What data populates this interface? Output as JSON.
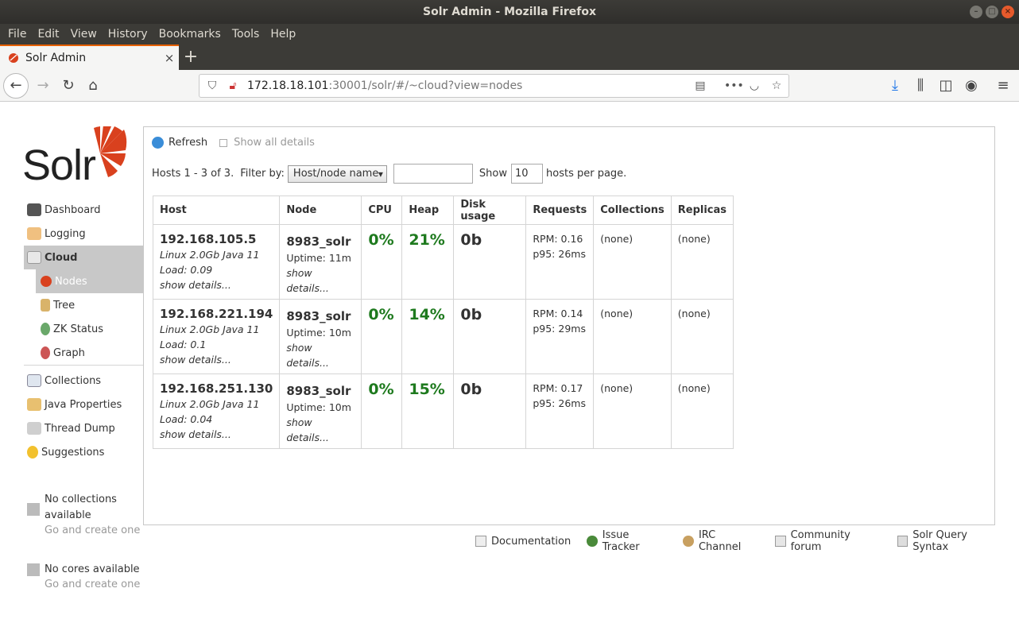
{
  "window": {
    "title": "Solr Admin - Mozilla Firefox",
    "buttons": [
      "–",
      "□",
      "×"
    ]
  },
  "menu": [
    "File",
    "Edit",
    "View",
    "History",
    "Bookmarks",
    "Tools",
    "Help"
  ],
  "tab": {
    "title": "Solr Admin",
    "close": "×",
    "new_tab": "+"
  },
  "url": {
    "host": "172.18.18.101",
    "rest": ":30001/solr/#/~cloud?view=nodes"
  },
  "logo_text": "Solr",
  "sidebar": {
    "items": [
      {
        "label": "Dashboard",
        "icon": "dashboard-icon"
      },
      {
        "label": "Logging",
        "icon": "logging-icon"
      },
      {
        "label": "Cloud",
        "icon": "cloud-icon",
        "active": true
      }
    ],
    "cloud_sub": [
      {
        "label": "Nodes",
        "icon": "solr-icon",
        "active": true
      },
      {
        "label": "Tree",
        "icon": "tree-icon"
      },
      {
        "label": "ZK Status",
        "icon": "zk-status-icon"
      },
      {
        "label": "Graph",
        "icon": "graph-icon"
      }
    ],
    "items2": [
      {
        "label": "Collections",
        "icon": "collections-icon"
      },
      {
        "label": "Java Properties",
        "icon": "java-icon"
      },
      {
        "label": "Thread Dump",
        "icon": "thread-dump-icon"
      },
      {
        "label": "Suggestions",
        "icon": "lightbulb-icon"
      }
    ],
    "no_collections": {
      "line1": "No collections",
      "line2": "available",
      "link": "Go and create one"
    },
    "no_cores": {
      "line1": "No cores available",
      "link": "Go and create one"
    }
  },
  "toolbar": {
    "refresh": "Refresh",
    "show_all": "Show all details",
    "hosts_summary": "Hosts 1 - 3 of 3.",
    "filter_label": "Filter by:",
    "filter_value": "Host/node name",
    "show_label": "Show",
    "per_page_value": "10",
    "per_page_suffix": "hosts per page."
  },
  "table": {
    "headers": [
      "Host",
      "Node",
      "CPU",
      "Heap",
      "Disk usage",
      "Requests",
      "Collections",
      "Replicas"
    ],
    "rows": [
      {
        "host": "192.168.105.5",
        "os": "Linux 2.0Gb Java 11",
        "load": "Load: 0.09",
        "host_details": "show details...",
        "node": "8983_solr",
        "uptime": "Uptime: 11m",
        "node_details": "show details...",
        "cpu": "0%",
        "heap": "21%",
        "disk": "0b",
        "rpm": "RPM: 0.16",
        "p95": "p95: 26ms",
        "collections": "(none)",
        "replicas": "(none)"
      },
      {
        "host": "192.168.221.194",
        "os": "Linux 2.0Gb Java 11",
        "load": "Load: 0.1",
        "host_details": "show details...",
        "node": "8983_solr",
        "uptime": "Uptime: 10m",
        "node_details": "show details...",
        "cpu": "0%",
        "heap": "14%",
        "disk": "0b",
        "rpm": "RPM: 0.14",
        "p95": "p95: 29ms",
        "collections": "(none)",
        "replicas": "(none)"
      },
      {
        "host": "192.168.251.130",
        "os": "Linux 2.0Gb Java 11",
        "load": "Load: 0.04",
        "host_details": "show details...",
        "node": "8983_solr",
        "uptime": "Uptime: 10m",
        "node_details": "show details...",
        "cpu": "0%",
        "heap": "15%",
        "disk": "0b",
        "rpm": "RPM: 0.17",
        "p95": "p95: 26ms",
        "collections": "(none)",
        "replicas": "(none)"
      }
    ]
  },
  "footer": [
    "Documentation",
    "Issue Tracker",
    "IRC Channel",
    "Community forum",
    "Solr Query Syntax"
  ],
  "colors": {
    "accent": "#e66000",
    "green": "#1e7a1e",
    "solr_red": "#d9411e"
  }
}
